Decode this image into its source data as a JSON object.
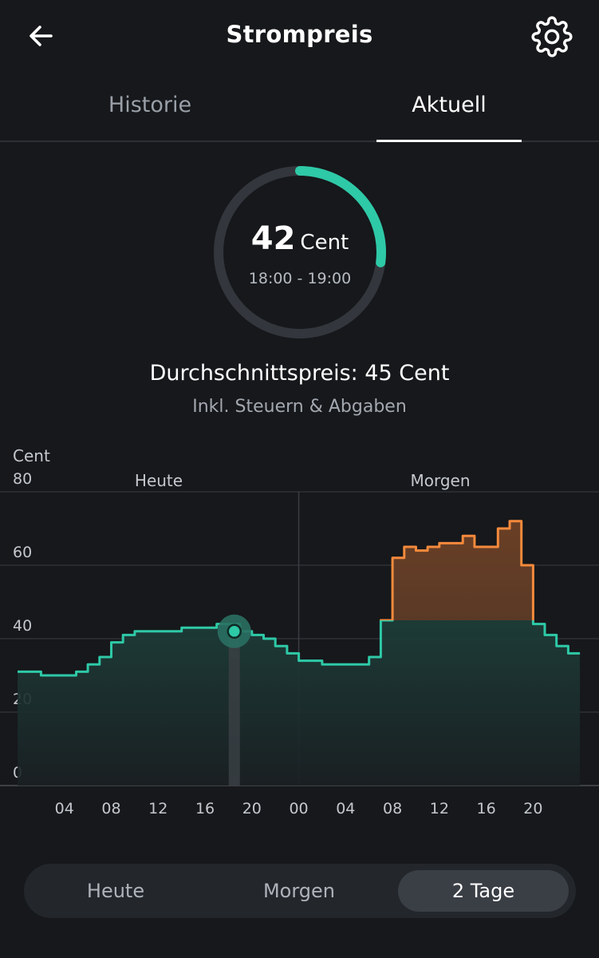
{
  "header": {
    "title": "Strompreis",
    "back_icon": "arrow-left-icon",
    "settings_icon": "gear-icon"
  },
  "tabs": [
    {
      "label": "Historie",
      "active": false
    },
    {
      "label": "Aktuell",
      "active": true
    }
  ],
  "current_price": {
    "value": "42",
    "unit": "Cent",
    "time_range": "18:00 - 19:00",
    "gauge_fraction": 0.27
  },
  "average": {
    "label": "Durchschnittspreis: 45 Cent",
    "subtitle": "Inkl. Steuern & Abgaben"
  },
  "colors": {
    "accent": "#2ec9a7",
    "orange": "#f58a3c",
    "background": "#16181b"
  },
  "chart_data": {
    "type": "area",
    "ylabel": "Cent",
    "ylim": [
      0,
      80
    ],
    "y_ticks": [
      "80",
      "60",
      "40",
      "20",
      "0"
    ],
    "x_ticks": [
      "04",
      "08",
      "12",
      "16",
      "20",
      "00",
      "04",
      "08",
      "12",
      "16",
      "20"
    ],
    "day_labels": [
      "Heute",
      "Morgen"
    ],
    "average_line": 45,
    "current": {
      "hour": 18,
      "value": 42
    },
    "series": [
      {
        "day": "Heute",
        "values": [
          31,
          31,
          30,
          30,
          30,
          31,
          33,
          35,
          39,
          41,
          42,
          42,
          42,
          42,
          43,
          43,
          43,
          44,
          44,
          42,
          41,
          40,
          38,
          36
        ]
      },
      {
        "day": "Morgen",
        "values": [
          34,
          34,
          33,
          33,
          33,
          33,
          35,
          45,
          62,
          65,
          64,
          65,
          66,
          66,
          68,
          65,
          65,
          70,
          72,
          60,
          44,
          41,
          38,
          36
        ]
      }
    ]
  },
  "segment": {
    "options": [
      "Heute",
      "Morgen",
      "2 Tage"
    ],
    "selected": "2 Tage"
  }
}
